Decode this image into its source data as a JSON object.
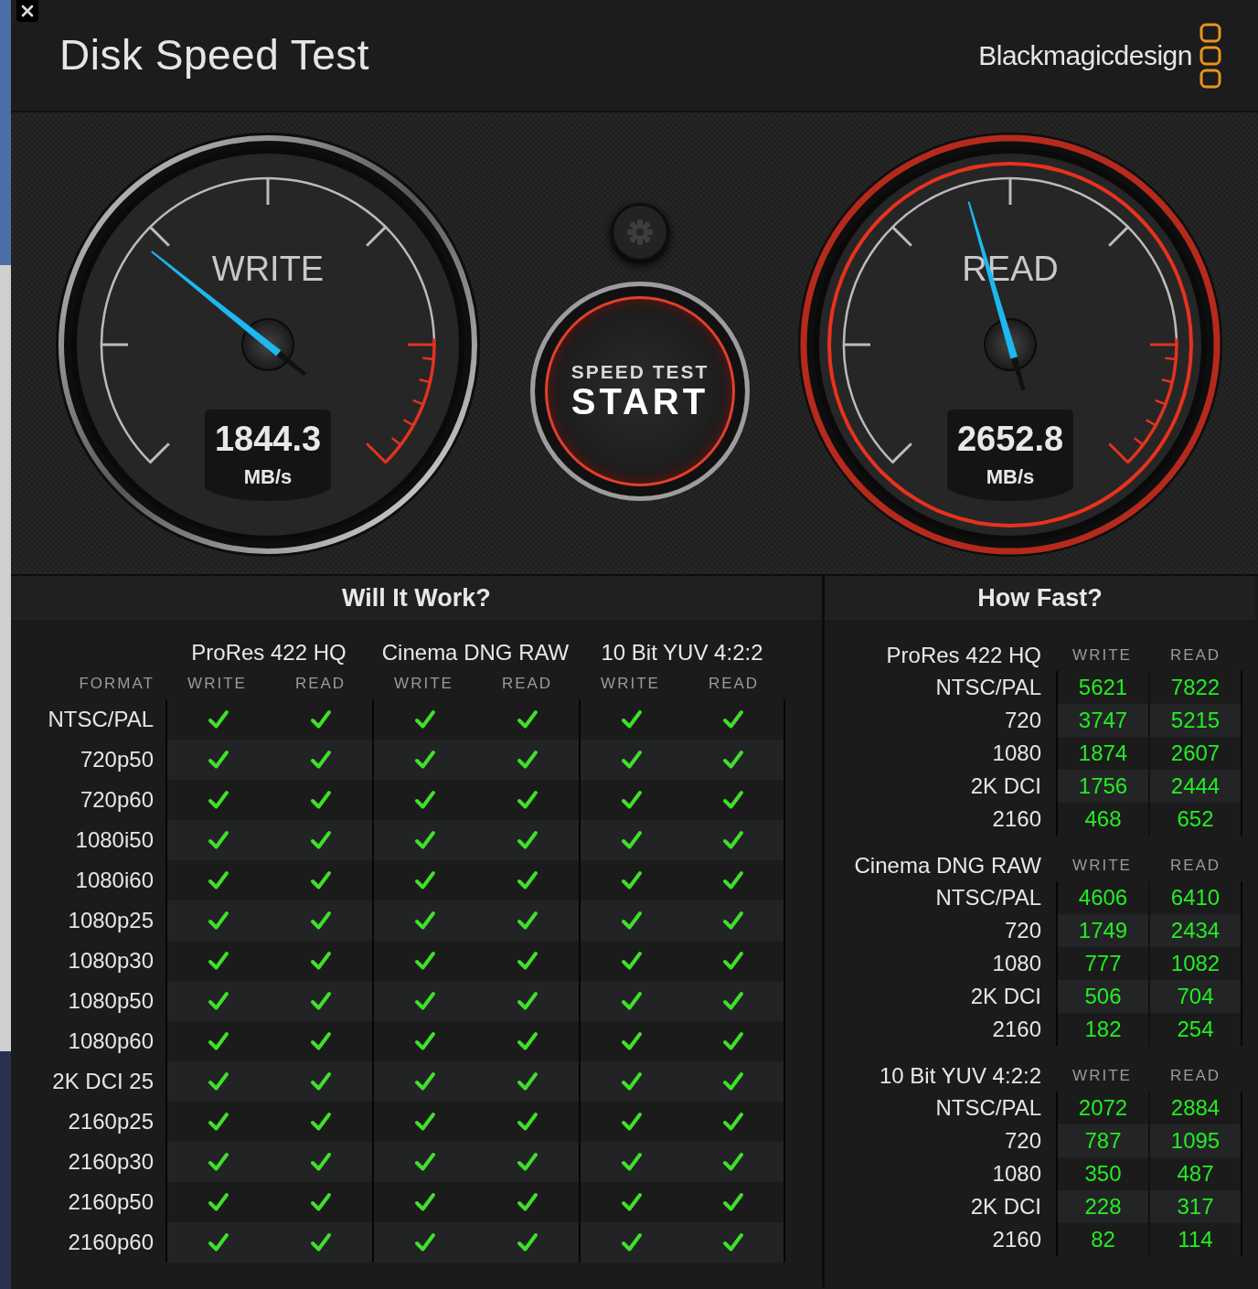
{
  "title": "Disk Speed Test",
  "brand": "Blackmagicdesign",
  "gauges": [
    {
      "label": "WRITE",
      "value": "1844.3",
      "unit": "MB/s",
      "level": 0.31,
      "active": false
    },
    {
      "label": "READ",
      "value": "2652.8",
      "unit": "MB/s",
      "level": 0.44,
      "active": true
    }
  ],
  "start_button": {
    "caption": "SPEED TEST",
    "label": "START"
  },
  "will_it_work": {
    "title": "Will It Work?",
    "format_label": "FORMAT",
    "codecs": [
      {
        "name": "ProRes 422 HQ",
        "columns": [
          "WRITE",
          "READ"
        ]
      },
      {
        "name": "Cinema DNG RAW",
        "columns": [
          "WRITE",
          "READ"
        ]
      },
      {
        "name": "10 Bit YUV 4:2:2",
        "columns": [
          "WRITE",
          "READ"
        ]
      }
    ],
    "rows": [
      {
        "format": "NTSC/PAL",
        "results": [
          true,
          true,
          true,
          true,
          true,
          true
        ]
      },
      {
        "format": "720p50",
        "results": [
          true,
          true,
          true,
          true,
          true,
          true
        ]
      },
      {
        "format": "720p60",
        "results": [
          true,
          true,
          true,
          true,
          true,
          true
        ]
      },
      {
        "format": "1080i50",
        "results": [
          true,
          true,
          true,
          true,
          true,
          true
        ]
      },
      {
        "format": "1080i60",
        "results": [
          true,
          true,
          true,
          true,
          true,
          true
        ]
      },
      {
        "format": "1080p25",
        "results": [
          true,
          true,
          true,
          true,
          true,
          true
        ]
      },
      {
        "format": "1080p30",
        "results": [
          true,
          true,
          true,
          true,
          true,
          true
        ]
      },
      {
        "format": "1080p50",
        "results": [
          true,
          true,
          true,
          true,
          true,
          true
        ]
      },
      {
        "format": "1080p60",
        "results": [
          true,
          true,
          true,
          true,
          true,
          true
        ]
      },
      {
        "format": "2K DCI 25",
        "results": [
          true,
          true,
          true,
          true,
          true,
          true
        ]
      },
      {
        "format": "2160p25",
        "results": [
          true,
          true,
          true,
          true,
          true,
          true
        ]
      },
      {
        "format": "2160p30",
        "results": [
          true,
          true,
          true,
          true,
          true,
          true
        ]
      },
      {
        "format": "2160p50",
        "results": [
          true,
          true,
          true,
          true,
          true,
          true
        ]
      },
      {
        "format": "2160p60",
        "results": [
          true,
          true,
          true,
          true,
          true,
          true
        ]
      }
    ]
  },
  "how_fast": {
    "title": "How Fast?",
    "groups": [
      {
        "name": "ProRes 422 HQ",
        "write_label": "WRITE",
        "read_label": "READ",
        "rows": [
          {
            "format": "NTSC/PAL",
            "write": "5621",
            "read": "7822"
          },
          {
            "format": "720",
            "write": "3747",
            "read": "5215"
          },
          {
            "format": "1080",
            "write": "1874",
            "read": "2607"
          },
          {
            "format": "2K DCI",
            "write": "1756",
            "read": "2444"
          },
          {
            "format": "2160",
            "write": "468",
            "read": "652"
          }
        ]
      },
      {
        "name": "Cinema DNG RAW",
        "write_label": "WRITE",
        "read_label": "READ",
        "rows": [
          {
            "format": "NTSC/PAL",
            "write": "4606",
            "read": "6410"
          },
          {
            "format": "720",
            "write": "1749",
            "read": "2434"
          },
          {
            "format": "1080",
            "write": "777",
            "read": "1082"
          },
          {
            "format": "2K DCI",
            "write": "506",
            "read": "704"
          },
          {
            "format": "2160",
            "write": "182",
            "read": "254"
          }
        ]
      },
      {
        "name": "10 Bit YUV 4:2:2",
        "write_label": "WRITE",
        "read_label": "READ",
        "rows": [
          {
            "format": "NTSC/PAL",
            "write": "2072",
            "read": "2884"
          },
          {
            "format": "720",
            "write": "787",
            "read": "1095"
          },
          {
            "format": "1080",
            "write": "350",
            "read": "487"
          },
          {
            "format": "2K DCI",
            "write": "228",
            "read": "317"
          },
          {
            "format": "2160",
            "write": "82",
            "read": "114"
          }
        ]
      }
    ]
  }
}
